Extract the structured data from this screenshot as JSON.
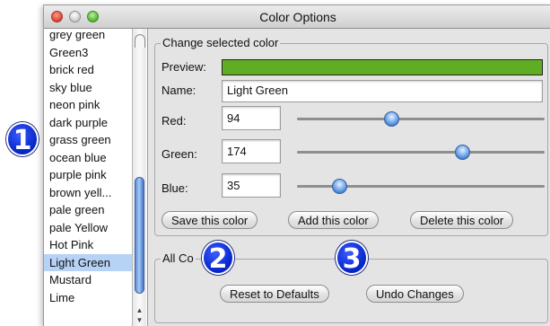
{
  "window": {
    "title": "Color Options"
  },
  "color_list": {
    "items": [
      "grey green",
      "Green3",
      "brick red",
      "sky blue",
      "neon pink",
      "dark purple",
      "grass green",
      "ocean blue",
      "purple pink",
      "brown yell...",
      "pale green",
      "pale Yellow",
      "Hot Pink",
      "Light Green",
      "Mustard",
      "Lime"
    ],
    "selected": "Light Green"
  },
  "editor": {
    "group_title": "Change selected color",
    "preview_label": "Preview:",
    "preview_color": "#5ead23",
    "name_label": "Name:",
    "name_value": "Light Green",
    "red_label": "Red:",
    "red_value": "94",
    "green_label": "Green:",
    "green_value": "174",
    "blue_label": "Blue:",
    "blue_value": "35",
    "slider_max": 255,
    "save_button": "Save this color",
    "add_button": "Add this color",
    "delete_button": "Delete this color"
  },
  "all_colors": {
    "group_title": "All Co",
    "reset_button": "Reset to Defaults",
    "undo_button": "Undo Changes"
  },
  "callouts": [
    "1",
    "2",
    "3"
  ],
  "colors": {
    "accent": "#2f69c2",
    "callout": "#0a2bd0",
    "selection": "#b6d2f4"
  }
}
